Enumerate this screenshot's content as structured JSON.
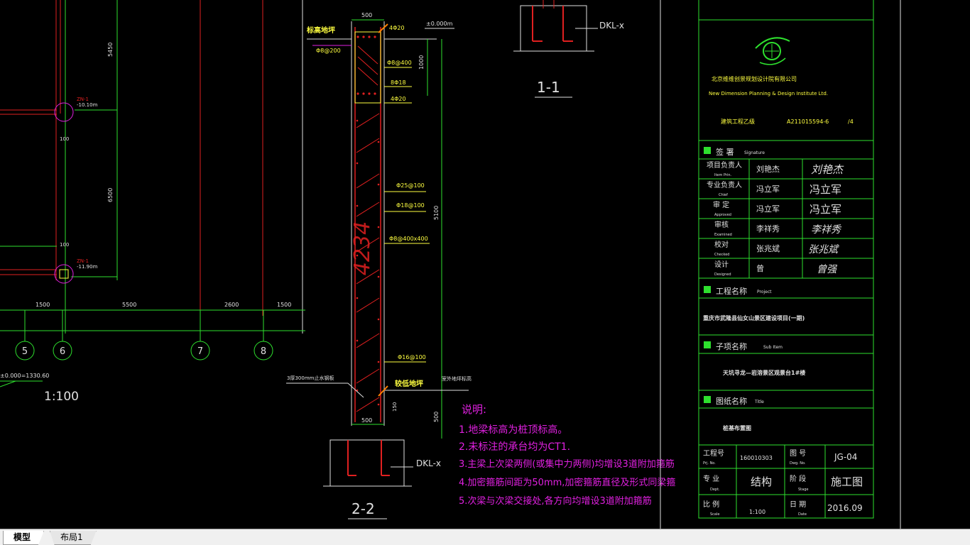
{
  "tabs": {
    "model": "模型",
    "layout1": "布局1"
  },
  "grid": {
    "axes": [
      "5",
      "6",
      "7",
      "8"
    ],
    "dims_bottom": [
      "1500",
      "5500",
      "2600",
      "1500"
    ],
    "dims_vertical": [
      "5450",
      "6500",
      "100",
      "100"
    ],
    "elev_1_tag": "ZN-1",
    "elev_1_val": "-10.10m",
    "elev_2_tag": "ZN-1",
    "elev_2_val": "-11.90m",
    "ref_level": "±0.000=1330.60",
    "scale": "1:100"
  },
  "section_1": {
    "label": "1-1",
    "beam": "DKL-x"
  },
  "section_2": {
    "label": "2-2",
    "beam": "DKL-x",
    "width_top": "500",
    "width_bottom": "500",
    "top_level": "±0.000m",
    "left_note": "标高地坪",
    "rebar_top": "4Φ20",
    "stirrup_top": "Φ8@200",
    "rebar_a": "Φ8@400",
    "rebar_b": "8Φ18",
    "rebar_c": "4Φ20",
    "dim_1000": "1000",
    "rebar_d": "Φ25@100",
    "rebar_e": "Φ18@100",
    "rebar_f": "Φ8@400x400",
    "dim_5100": "5100",
    "numbers": "4234",
    "rebar_g": "Φ16@100",
    "waterstop": "3厚300mm止水钢板",
    "bottom_note": "较低地坪",
    "right_note": "室外地坪标高",
    "dim_150": "150",
    "dim_500": "500"
  },
  "notes": {
    "title": "说明:",
    "lines": [
      "1.地梁标高为桩顶标高。",
      "2.未标注的承台均为CT1.",
      "3.主梁上次梁两侧(或集中力两侧)均增设3道附加箍筋",
      "4.加密箍筋间距为50mm,加密箍筋直径及形式同梁箍",
      "5.次梁与次梁交接处,各方向均增设3道附加箍筋"
    ]
  },
  "title_block": {
    "company_cn": "北京维维创景规划设计院有限公司",
    "company_en": "New  Dimension   Planning   & Design  Institute   Ltd.",
    "cert_label": "建筑工程乙级",
    "cert_no": "A211015594-6",
    "cert_suffix": "/4",
    "signature_header": "签 署",
    "signature_header_en": "Signature",
    "roles": [
      {
        "cn": "项目负责人",
        "en": "Item Prin.",
        "name": "刘艳杰",
        "sig": "刘艳杰"
      },
      {
        "cn": "专业负责人",
        "en": "Chief",
        "name": "冯立军",
        "sig": "冯立军"
      },
      {
        "cn": "审 定",
        "en": "Approved",
        "name": "冯立军",
        "sig": "冯立军"
      },
      {
        "cn": "审核",
        "en": "Examined",
        "name": "李祥秀",
        "sig": "李祥秀"
      },
      {
        "cn": "校对",
        "en": "Checked",
        "name": "张兆斌",
        "sig": "张兆斌"
      },
      {
        "cn": "设计",
        "en": "Designed",
        "name": "曾",
        "sig": "曾强"
      }
    ],
    "project_header": "工程名称",
    "project_header_en": "Project",
    "project_name": "重庆市武隆县仙女山景区建设项目(一期)",
    "sub_header": "子项名称",
    "sub_header_en": "Sub Item",
    "sub_name": "天坑寻龙—岩溶景区观景台1#楼",
    "drawing_header": "图纸名称",
    "drawing_header_en": "Title",
    "drawing_name": "桩基布置图",
    "job_no_label": "工程号",
    "job_no_label_en": "Prj. No.",
    "job_no": "160010303",
    "dwg_no_label": "图 号",
    "dwg_no_label_en": "Dwg. No.",
    "dwg_no": "JG-04",
    "dept_label": "专 业",
    "dept_label_en": "Dept.",
    "dept": "结构",
    "stage_label": "阶 段",
    "stage_label_en": "Stage",
    "stage": "施工图",
    "scale_label": "比 例",
    "scale_label_en": "Scale",
    "scale": "1:100",
    "date_label": "日 期",
    "date_label_en": "Date",
    "date": "2016.09"
  }
}
